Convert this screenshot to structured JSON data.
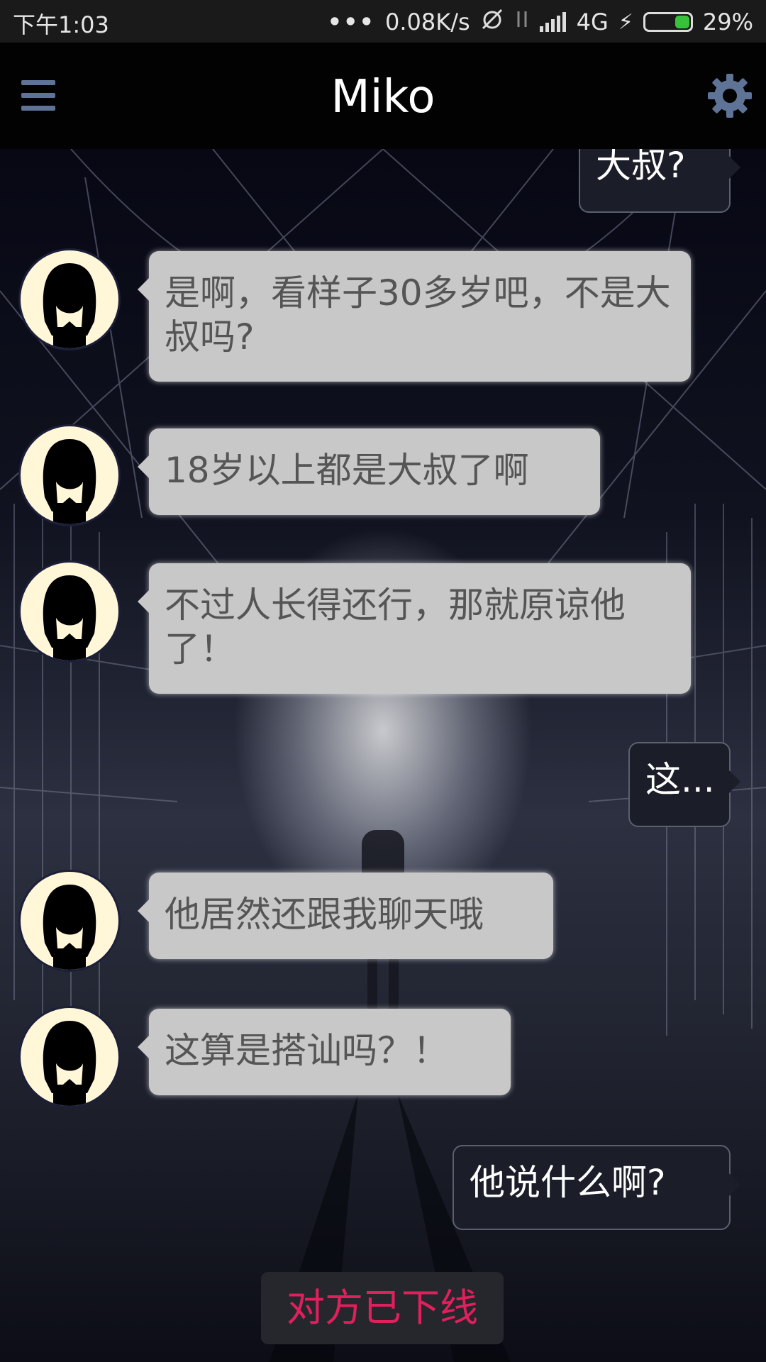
{
  "status_bar": {
    "time": "下午1:03",
    "more": "•••",
    "speed": "0.08K/s",
    "network": "4G",
    "battery": "29%",
    "battery_level": 0.29
  },
  "header": {
    "title": "Miko",
    "menu_icon": "hamburger-menu-icon",
    "settings_icon": "gear-icon"
  },
  "messages": [
    {
      "from": "me",
      "text": "大叔?"
    },
    {
      "from": "miko",
      "text": "是啊，看样子30多岁吧，不是大叔吗?"
    },
    {
      "from": "miko",
      "text": "18岁以上都是大叔了啊"
    },
    {
      "from": "miko",
      "text": "不过人长得还行，那就原谅他了！"
    },
    {
      "from": "me",
      "text": "这..."
    },
    {
      "from": "miko",
      "text": "他居然还跟我聊天哦"
    },
    {
      "from": "miko",
      "text": "这算是搭讪吗？！"
    },
    {
      "from": "me",
      "text": "他说什么啊?"
    }
  ],
  "status_notice": "对方已下线",
  "colors": {
    "incoming_bubble": "#c8c8c8",
    "outgoing_bubble": "#1b1e28",
    "notice_text": "#e0205c",
    "icon_accent": "#5f7396"
  }
}
